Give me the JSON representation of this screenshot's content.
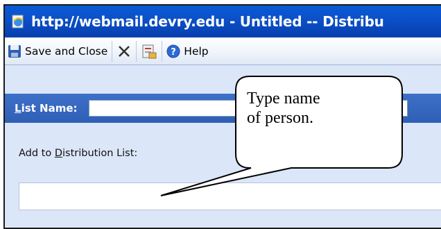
{
  "window": {
    "title": "http://webmail.devry.edu - Untitled -- Distribu"
  },
  "toolbar": {
    "save_close_label": "Save and Close",
    "help_label": "Help"
  },
  "form": {
    "list_name_label_first": "L",
    "list_name_label_rest": "ist Name:",
    "list_name_value": "",
    "add_to_label_before": "Add to ",
    "add_to_label_accel": "D",
    "add_to_label_after": "istribution List:",
    "add_to_value": ""
  },
  "callout": {
    "line1": "Type name",
    "line2": "of person."
  },
  "icons": {
    "title": "ie-page-icon",
    "save": "floppy-disk-icon",
    "delete": "x-delete-icon",
    "address_book": "address-book-icon",
    "help": "help-icon"
  },
  "colors": {
    "titlebar": "#0b4fc7",
    "list_name_bar": "#3563b9",
    "content_bg": "#dbe7f8"
  }
}
